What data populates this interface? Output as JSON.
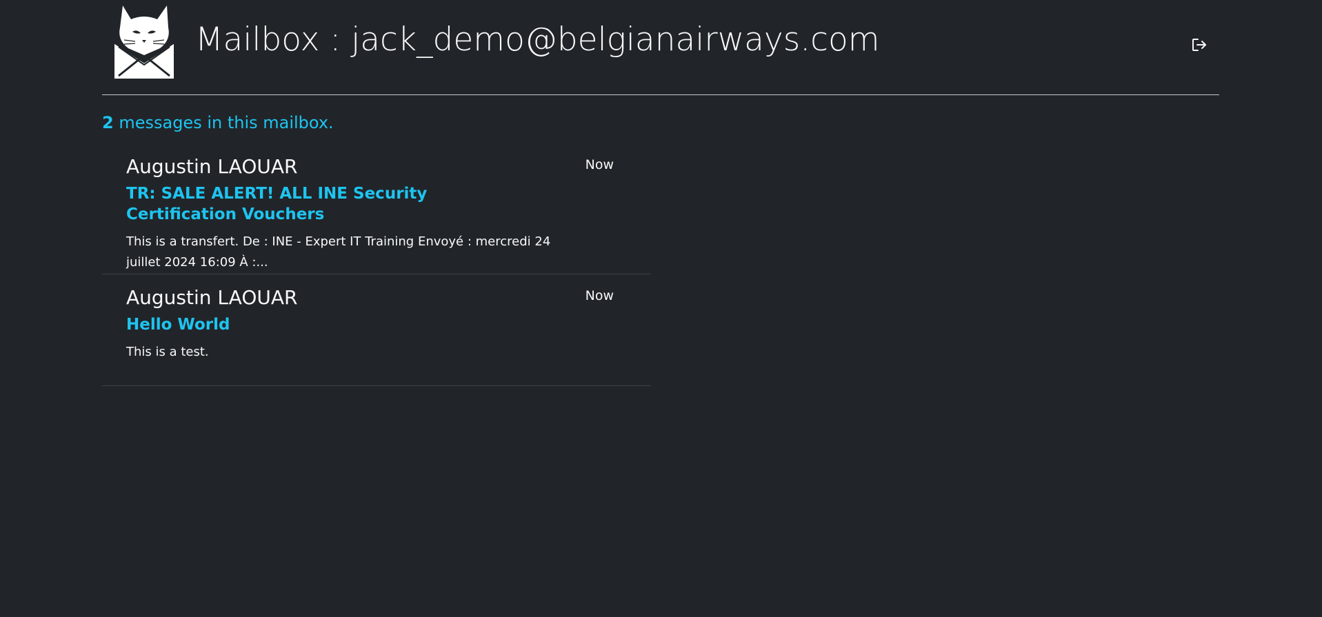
{
  "header": {
    "title": "Mailbox : jack_demo@belgianairways.com",
    "logo_icon": "cat-envelope-logo-icon",
    "logout_icon": "logout-icon"
  },
  "summary": {
    "count": "2",
    "text": " messages in this mailbox."
  },
  "messages": [
    {
      "sender": "Augustin LAOUAR",
      "time": "Now",
      "subject": "TR: SALE ALERT! ALL INE Security Certification Vouchers",
      "preview": "This is a transfert. De : INE - Expert IT Training Envoyé : mercredi 24 juillet 2024 16:09 À :..."
    },
    {
      "sender": "Augustin LAOUAR",
      "time": "Now",
      "subject": "Hello World",
      "preview": "This is a test."
    }
  ],
  "colors": {
    "background": "#212529",
    "accent": "#1ec4f0",
    "text": "#f8f9fa"
  }
}
